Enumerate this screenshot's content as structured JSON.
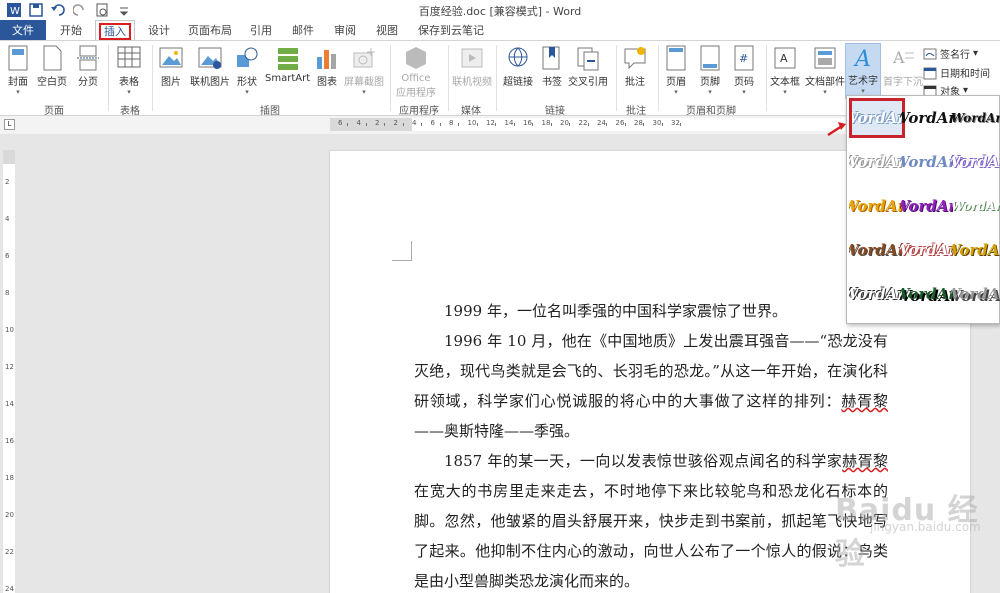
{
  "window": {
    "title": "百度经验.doc [兼容模式] - Word"
  },
  "tabs": {
    "file": "文件",
    "items": [
      "开始",
      "插入",
      "设计",
      "页面布局",
      "引用",
      "邮件",
      "审阅",
      "视图",
      "保存到云笔记"
    ]
  },
  "ribbon": {
    "pages": {
      "label": "页面",
      "cover": "封面",
      "blank": "空白页",
      "break": "分页"
    },
    "tables": {
      "label": "表格",
      "table": "表格"
    },
    "illustrations": {
      "label": "插图",
      "picture": "图片",
      "online_picture": "联机图片",
      "shapes": "形状",
      "smartart": "SmartArt",
      "chart": "图表",
      "screenshot": "屏幕截图"
    },
    "apps": {
      "label": "应用程序",
      "office_line1": "Office",
      "office_line2": "应用程序"
    },
    "media": {
      "label": "媒体",
      "online_video": "联机视频"
    },
    "links": {
      "label": "链接",
      "hyperlink": "超链接",
      "bookmark": "书签",
      "cross_ref": "交叉引用"
    },
    "comments": {
      "label": "批注",
      "comment": "批注"
    },
    "header_footer": {
      "label": "页眉和页脚",
      "header": "页眉",
      "footer": "页脚",
      "page_number": "页码"
    },
    "text": {
      "textbox": "文本框",
      "quick_parts": "文档部件",
      "wordart": "艺术字",
      "dropcap": "首字下沉",
      "signature": "签名行",
      "datetime": "日期和时间",
      "object": "对象"
    }
  },
  "ruler": {
    "h_numbers": [
      "6",
      "4",
      "2",
      "2",
      "4",
      "6",
      "8",
      "10",
      "12",
      "14",
      "16",
      "18",
      "20",
      "22",
      "24",
      "26",
      "28",
      "30",
      "32"
    ],
    "v_numbers": [
      "2",
      "4",
      "6",
      "8",
      "10",
      "12",
      "14",
      "16",
      "18",
      "20",
      "22",
      "24"
    ]
  },
  "document": {
    "p1": "1999 年，一位名叫季强的中国科学家震惊了世界。",
    "p2_a": "1996 年 10 月，他在《中国地质》上发出震耳强音——“恐龙没有灭绝，现代鸟类就是会飞的、长羽毛的恐龙。”从这一年开始，在演化科研领域，科学家们心悦诚服的将心中的大事做了这样的排列：",
    "p2_name": "赫胥黎",
    "p2_b": "——奥斯特隆——季强。",
    "p3_a": "1857 年的某一天，一向以发表惊世骇俗观点闻名的科学家",
    "p3_name": "赫胥黎",
    "p3_b": "在宽大的书房里走来走去，不时地停下来比较鸵鸟和恐龙化石标本的脚。忽然，他皱紧的眉头舒展开来，快步走到书案前，抓起笔飞快地写了起来。他抑制不住内心的激动，向世人公布了一个惊人的假说：鸟类是由小型兽脚类恐龙演化而来的。"
  },
  "wordart_gallery": {
    "sample": "WordArt",
    "rows": 5,
    "cols": 3
  },
  "watermark": {
    "text": "Baidu 经验",
    "sub": "jingyan.baidu.com"
  },
  "colors": {
    "accent": "#2b579a",
    "highlight": "#d81e1e",
    "selected_fill": "#c5d9f1"
  }
}
